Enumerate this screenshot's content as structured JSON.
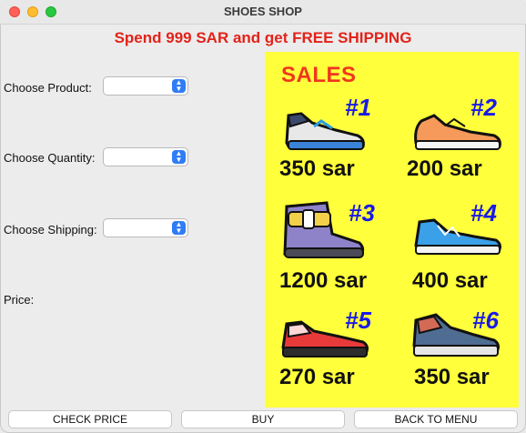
{
  "window": {
    "title": "SHOES SHOP"
  },
  "promo": {
    "text": "Spend 999 SAR and get FREE SHIPPING"
  },
  "form": {
    "product_label": "Choose Product:",
    "quantity_label": "Choose Quantity:",
    "shipping_label": "Choose Shipping:",
    "price_label": "Price:",
    "product_value": "",
    "quantity_value": "",
    "shipping_value": ""
  },
  "sales": {
    "title": "SALES",
    "items": [
      {
        "number": "#1",
        "price": "350 sar",
        "icon": "shoe-1-icon"
      },
      {
        "number": "#2",
        "price": "200 sar",
        "icon": "shoe-2-icon"
      },
      {
        "number": "#3",
        "price": "1200 sar",
        "icon": "shoe-3-icon"
      },
      {
        "number": "#4",
        "price": "400 sar",
        "icon": "shoe-4-icon"
      },
      {
        "number": "#5",
        "price": "270 sar",
        "icon": "shoe-5-icon"
      },
      {
        "number": "#6",
        "price": "350 sar",
        "icon": "shoe-6-icon"
      }
    ]
  },
  "buttons": {
    "check_price": "CHECK PRICE",
    "buy": "BUY",
    "back": "BACK TO MENU"
  },
  "colors": {
    "promo": "#e2231a",
    "panel_bg": "#ffff3b",
    "sales_title": "#f0361c",
    "item_number": "#1a1ae6",
    "combo_button": "#2f7cf6"
  }
}
